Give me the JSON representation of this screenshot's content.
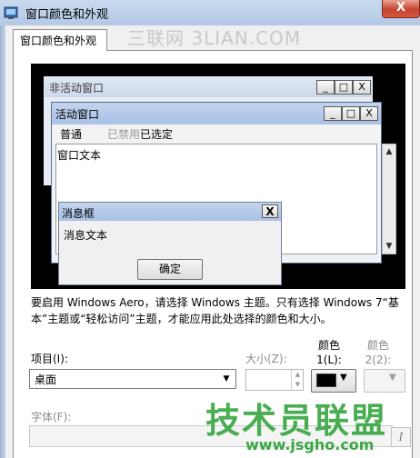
{
  "window": {
    "title": "窗口颜色和外观",
    "close": "X"
  },
  "tab": {
    "label": "窗口颜色和外观"
  },
  "watermark_top": "三联网 3LIAN.COM",
  "preview": {
    "inactive_title": "非活动窗口",
    "active_title": "活动窗口",
    "menu": [
      "普通",
      "已禁用",
      "已选定"
    ],
    "content_text": "窗口文本",
    "msgbox_title": "消息框",
    "msgbox_text": "消息文本",
    "ok_label": "确定",
    "ctl_min": "_",
    "ctl_max": "□",
    "ctl_close": "X",
    "scroll_up": "▲",
    "scroll_down": "▼"
  },
  "description": "要启用 Windows Aero，请选择 Windows 主题。只有选择 Windows 7“基本”主题或“轻松访问”主题，才能应用此处选择的颜色和大小。",
  "item": {
    "label": "项目(I):",
    "value": "桌面",
    "arrow": "▼"
  },
  "size": {
    "label": "大小(Z):",
    "value": "",
    "up": "▲",
    "down": "▼"
  },
  "color1": {
    "label_line1": "颜色",
    "label_line2": "1(L):",
    "swatch": "#000000",
    "arrow": "▼"
  },
  "color2": {
    "label_line1": "颜色",
    "label_line2": "2(2):",
    "arrow": "▼"
  },
  "font": {
    "label": "字体(F):",
    "italic": "I"
  },
  "watermark_bottom": {
    "title": "技术员联盟",
    "url": "www.jsgho.com"
  },
  "colors": {
    "accent": "#3aa843",
    "titlebar": "#b9cbe6",
    "close": "#c7452f"
  }
}
